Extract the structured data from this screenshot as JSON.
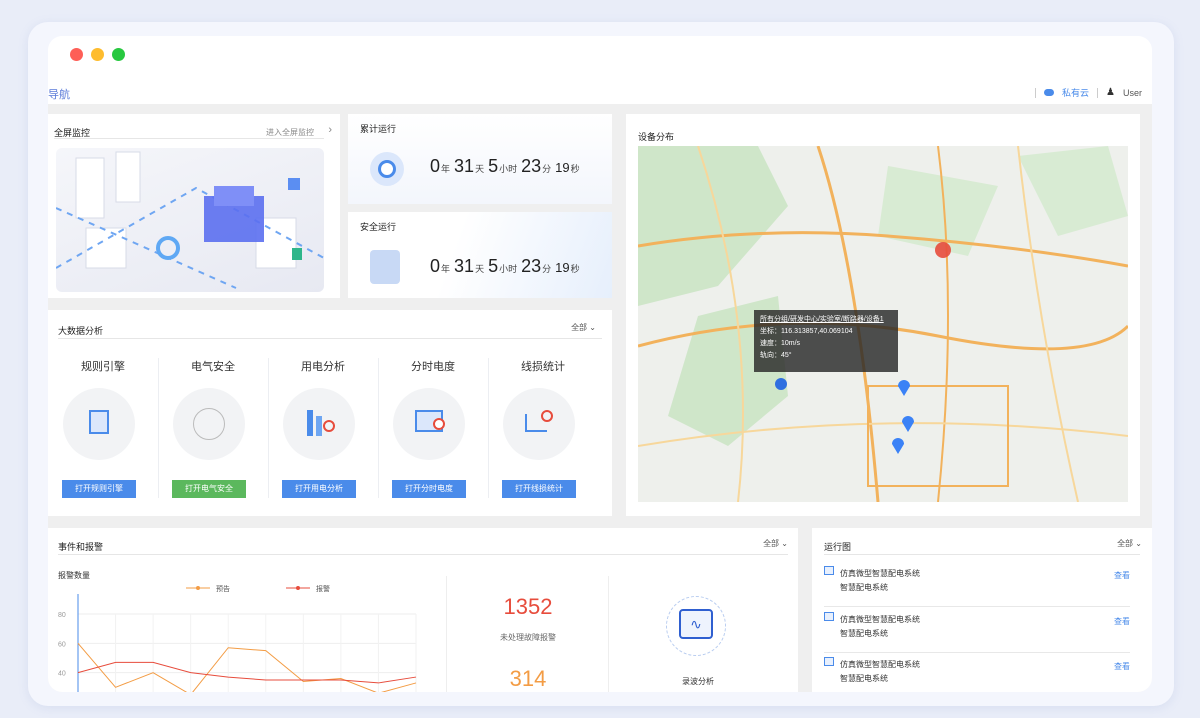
{
  "nav": {
    "label": "导航",
    "cloud_label": "私有云",
    "user_label": "User"
  },
  "panels": {
    "fullscreen": {
      "title": "全屏监控",
      "link": "进入全屏监控"
    },
    "cumulative": {
      "title": "累计运行",
      "years": "0",
      "year_unit": "年",
      "days": "31",
      "day_unit": "天",
      "hours": "5",
      "hour_unit": "小时",
      "minutes": "23",
      "minute_unit": "分",
      "seconds": "19",
      "second_unit": "秒"
    },
    "safe": {
      "title": "安全运行",
      "years": "0",
      "year_unit": "年",
      "days": "31",
      "day_unit": "天",
      "hours": "5",
      "hour_unit": "小时",
      "minutes": "23",
      "minute_unit": "分",
      "seconds": "19",
      "second_unit": "秒"
    },
    "device": {
      "title": "设备分布"
    },
    "bigdata": {
      "title": "大数据分析",
      "filter": "全部"
    },
    "events": {
      "title": "事件和报警",
      "filter": "全部"
    },
    "run": {
      "title": "运行图",
      "filter": "全部"
    }
  },
  "map_popup": {
    "path": "所有分组/研发中心/实验室/断路器/设备1",
    "coord": "坐标：116.313857,40.069104",
    "speed": "速度：10m/s",
    "heading": "轨向：45°"
  },
  "modules": [
    {
      "name": "规则引擎",
      "button": "打开规则引擎",
      "color": "#4a8bea"
    },
    {
      "name": "电气安全",
      "button": "打开电气安全",
      "color": "#5bb85d"
    },
    {
      "name": "用电分析",
      "button": "打开用电分析",
      "color": "#4a8bea"
    },
    {
      "name": "分时电度",
      "button": "打开分时电度",
      "color": "#4a8bea"
    },
    {
      "name": "线损统计",
      "button": "打开线损统计",
      "color": "#4a8bea"
    }
  ],
  "alarm_stats": {
    "unprocessed_count": "1352",
    "unprocessed_label": "未处理故障报警",
    "second_count": "314",
    "wave_label": "录波分析"
  },
  "run_list": [
    {
      "line1": "仿真微型智慧配电系统",
      "line2": "智慧配电系统",
      "action": "查看"
    },
    {
      "line1": "仿真微型智慧配电系统",
      "line2": "智慧配电系统",
      "action": "查看"
    },
    {
      "line1": "仿真微型智慧配电系统",
      "line2": "智慧配电系统",
      "action": "查看"
    }
  ],
  "chart_data": {
    "type": "line",
    "title": "报警数量",
    "yticks": [
      "80",
      "60",
      "40",
      "20"
    ],
    "ylim": [
      20,
      80
    ],
    "legend_position": "top",
    "grid": true,
    "series": [
      {
        "name": "预告",
        "color": "#f39c44",
        "values": [
          60,
          30,
          40,
          25,
          57,
          55,
          34,
          36,
          26,
          33
        ]
      },
      {
        "name": "报警",
        "color": "#e74c3c",
        "values": [
          40,
          47,
          47,
          40,
          37,
          35,
          35,
          35,
          33,
          37
        ]
      }
    ]
  },
  "colors": {
    "primary": "#4a8bea",
    "green": "#5bb85d",
    "alarm_red": "#e74c3c",
    "alarm_orange": "#f39c44"
  }
}
